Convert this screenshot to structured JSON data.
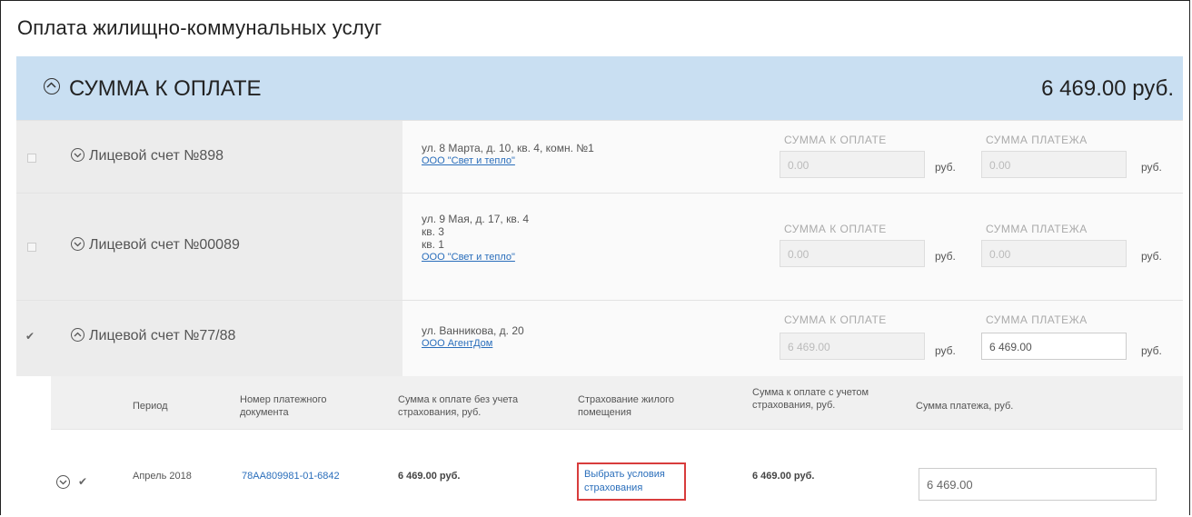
{
  "page": {
    "title": "Оплата жилищно-коммунальных услуг"
  },
  "summary": {
    "label": "СУММА К ОПЛАТЕ",
    "amount": "6 469.00 руб."
  },
  "accounts": [
    {
      "label": "Лицевой счет №898",
      "checked": false,
      "address": [
        "ул. 8 Марта, д. 10, кв. 4, комн. №1"
      ],
      "org": "ООО \"Свет и тепло\"",
      "due_label": "СУММА К ОПЛАТЕ",
      "due_value": "0.00",
      "pay_label": "СУММА ПЛАТЕЖА",
      "pay_value": "0.00",
      "currency": "руб."
    },
    {
      "label": "Лицевой счет №00089",
      "checked": false,
      "address": [
        "ул. 9 Мая, д. 17, кв. 4",
        "кв. 3",
        "кв. 1"
      ],
      "org": "ООО \"Свет и тепло\"",
      "due_label": "СУММА К ОПЛАТЕ",
      "due_value": "0.00",
      "pay_label": "СУММА ПЛАТЕЖА",
      "pay_value": "0.00",
      "currency": "руб."
    },
    {
      "label": "Лицевой счет №77/88",
      "checked": true,
      "address": [
        "ул. Ванникова, д. 20"
      ],
      "org": "ООО АгентДом",
      "due_label": "СУММА К ОПЛАТЕ",
      "due_value": "6 469.00",
      "pay_label": "СУММА ПЛАТЕЖА",
      "pay_value": "6 469.00",
      "currency": "руб."
    }
  ],
  "detail_table": {
    "headers": [
      "Период",
      "Номер платежного документа",
      "Сумма к оплате без учета страхования, руб.",
      "Страхование жилого помещения",
      "Сумма к оплате с учетом страхования, руб.",
      "Сумма платежа, руб."
    ],
    "row": {
      "period": "Апрель 2018",
      "doc_number": "78АА809981-01-6842",
      "due_without_insurance": "6 469.00 руб.",
      "insurance_link": "Выбрать условия страхования",
      "due_with_insurance": "6 469.00 руб.",
      "payment": "6 469.00"
    }
  }
}
